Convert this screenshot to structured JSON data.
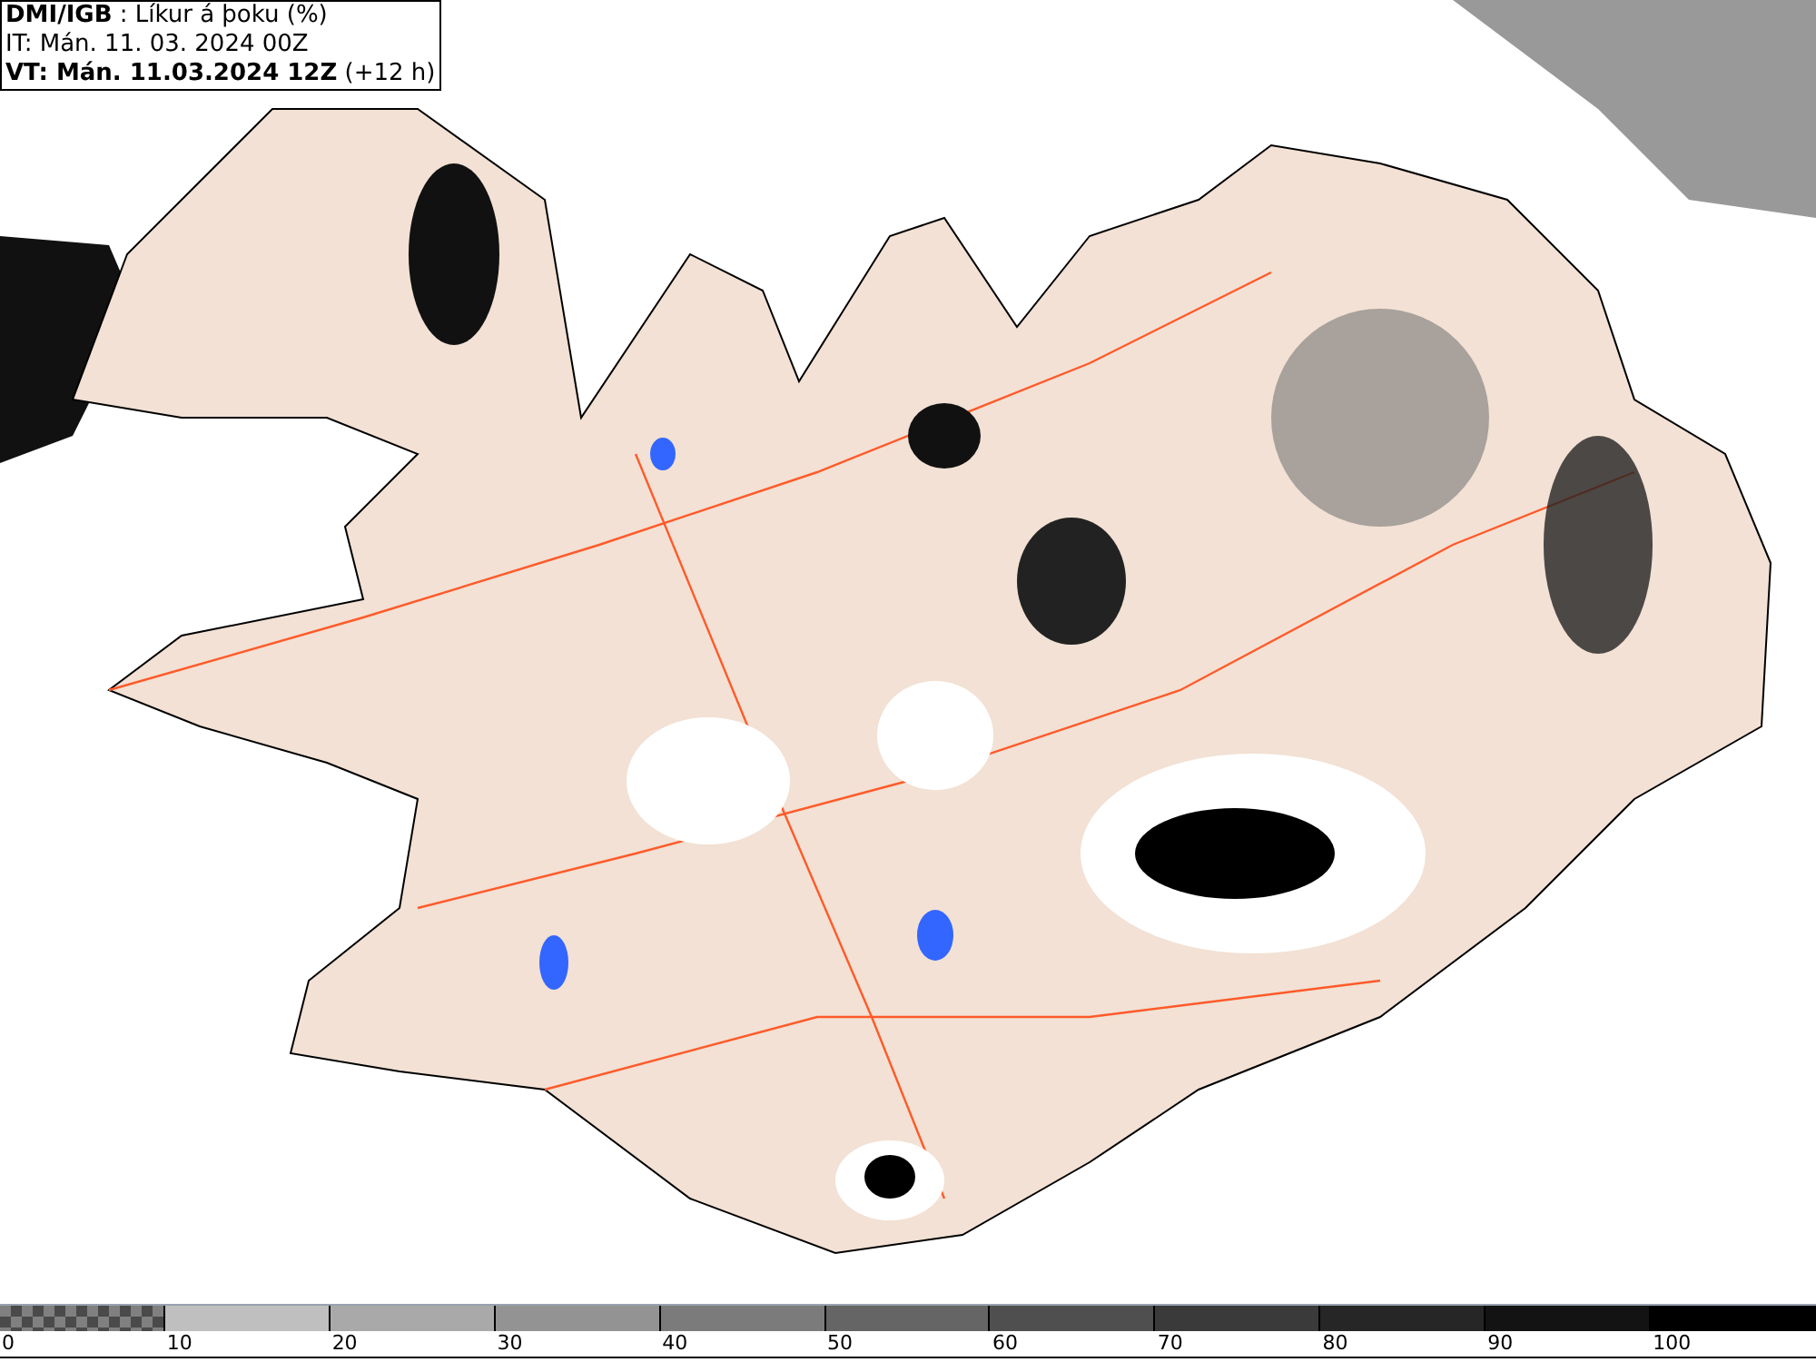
{
  "header": {
    "title": "**DMI/IGB** : Líkur á þoku (%)",
    "initial_time": "IT: Mán. 11. 03. 2024 00Z",
    "valid_time": "**VT: Mán. 11.03.2024 12Z** (+12 h)"
  },
  "legend": {
    "segments": [
      {
        "kind": "checker",
        "color": "#808080",
        "label": "0"
      },
      {
        "kind": "solid",
        "color": "#bfbfbf",
        "label": "10"
      },
      {
        "kind": "solid",
        "color": "#a9a9a9",
        "label": "20"
      },
      {
        "kind": "solid",
        "color": "#939393",
        "label": "30"
      },
      {
        "kind": "solid",
        "color": "#7b7b7b",
        "label": "40"
      },
      {
        "kind": "solid",
        "color": "#656565",
        "label": "50"
      },
      {
        "kind": "solid",
        "color": "#4f4f4f",
        "label": "60"
      },
      {
        "kind": "solid",
        "color": "#3a3a3a",
        "label": "70"
      },
      {
        "kind": "solid",
        "color": "#262626",
        "label": "80"
      },
      {
        "kind": "solid",
        "color": "#131313",
        "label": "90"
      },
      {
        "kind": "solid",
        "color": "#000000",
        "label": "100"
      }
    ]
  }
}
